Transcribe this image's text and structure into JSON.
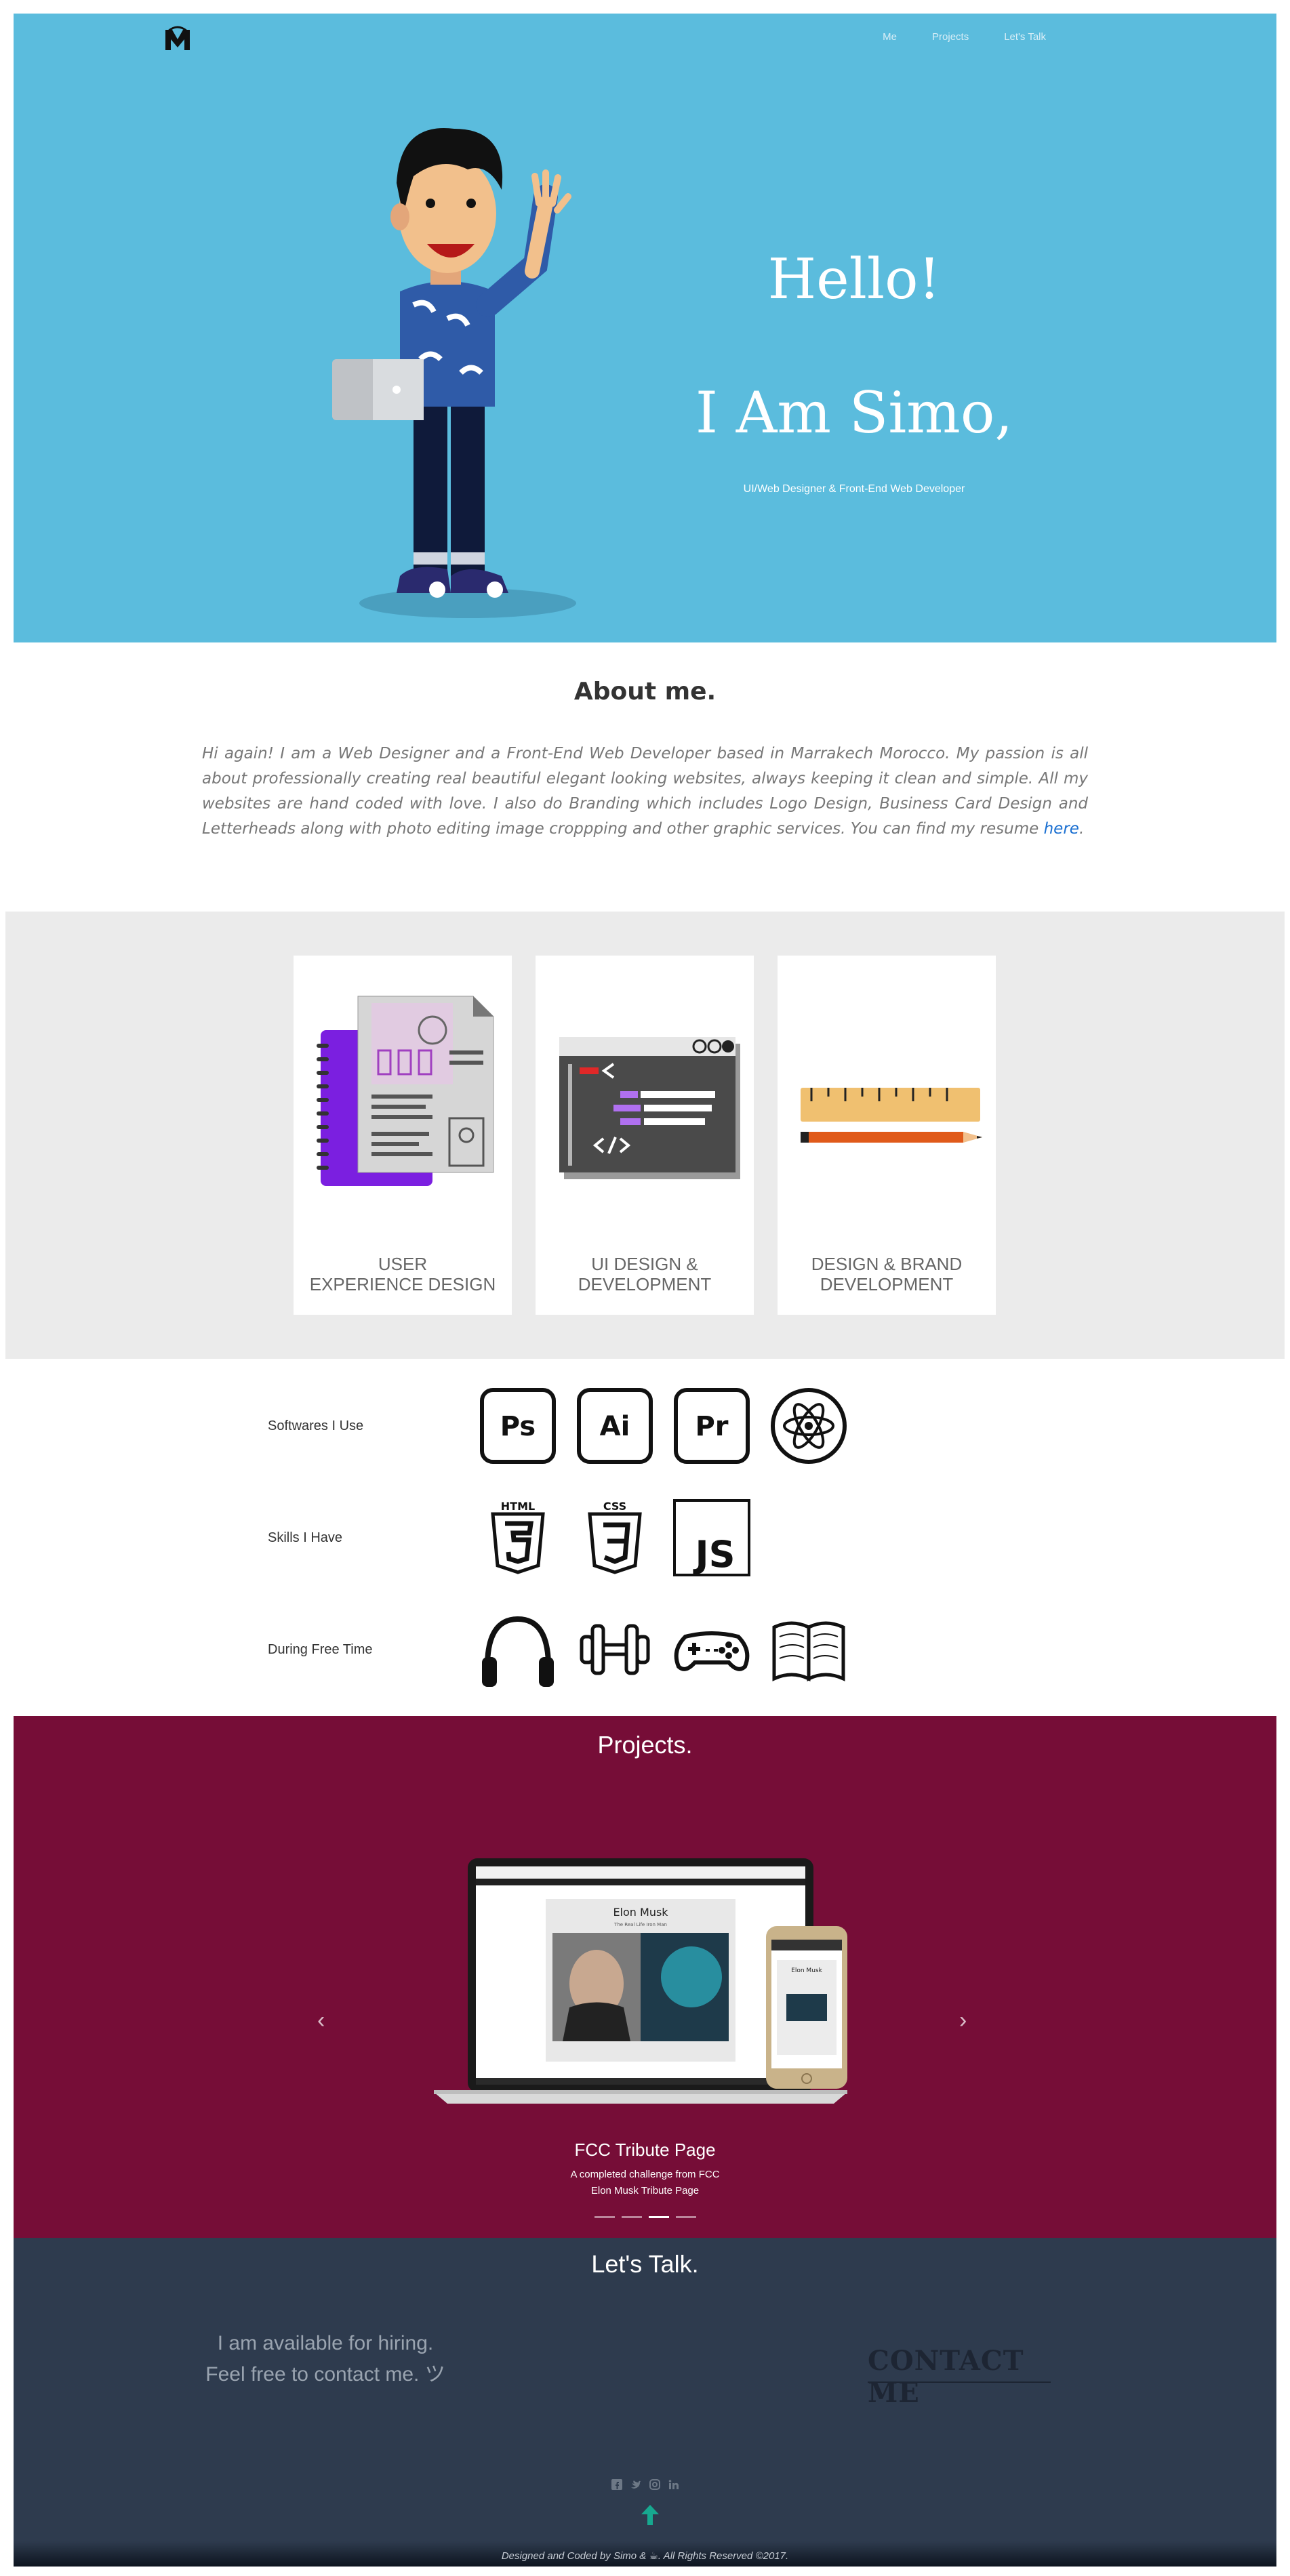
{
  "nav": {
    "items": [
      "Me",
      "Projects",
      "Let's Talk"
    ]
  },
  "hero": {
    "greeting": "Hello!",
    "name": "I Am Simo,",
    "role": "UI/Web Designer & Front-End Web Developer"
  },
  "about": {
    "title": "About me.",
    "text": "Hi again! I am a Web Designer and a Front-End Web Developer based in Marrakech Morocco. My passion is all about professionally creating real beautiful elegant looking websites, always keeping it clean and simple. All my websites are hand coded with love. I also do Branding which includes Logo Design, Business Card Design and Letterheads along with photo editing image croppping and other graphic services. You can find my resume ",
    "link": "here",
    "end": "."
  },
  "services": [
    {
      "line1": "USER",
      "line2": "EXPERIENCE DESIGN"
    },
    {
      "line1": "UI DESIGN &",
      "line2": "DEVELOPMENT"
    },
    {
      "line1": "DESIGN & BRAND",
      "line2": "DEVELOPMENT"
    }
  ],
  "skills": {
    "software_label": "Softwares I Use",
    "software_icons": [
      "Ps",
      "Ai",
      "Pr"
    ],
    "skills_label": "Skills I Have",
    "skills_icons": [
      "HTML",
      "CSS",
      "JS"
    ],
    "freetime_label": "During Free Time"
  },
  "projects": {
    "title": "Projects.",
    "caption_title": "FCC Tribute Page",
    "caption_line1": "A completed challenge from FCC",
    "caption_line2": "Elon Musk Tribute Page",
    "screen_title": "Elon Musk",
    "screen_subtitle": "The Real Life Iron Man"
  },
  "contact": {
    "title": "Let's Talk.",
    "line1": "I am available for hiring.",
    "line2": "Feel free to contact me. ツ",
    "button": "CONTACT ME",
    "footer": "Designed and Coded by Simo & ☕. All Rights Reserved ©2017."
  },
  "colors": {
    "hero_bg": "#5bbcdd",
    "projects_bg": "#760d37",
    "contact_bg": "#2e3b4e",
    "services_bg": "#ebebeb"
  }
}
